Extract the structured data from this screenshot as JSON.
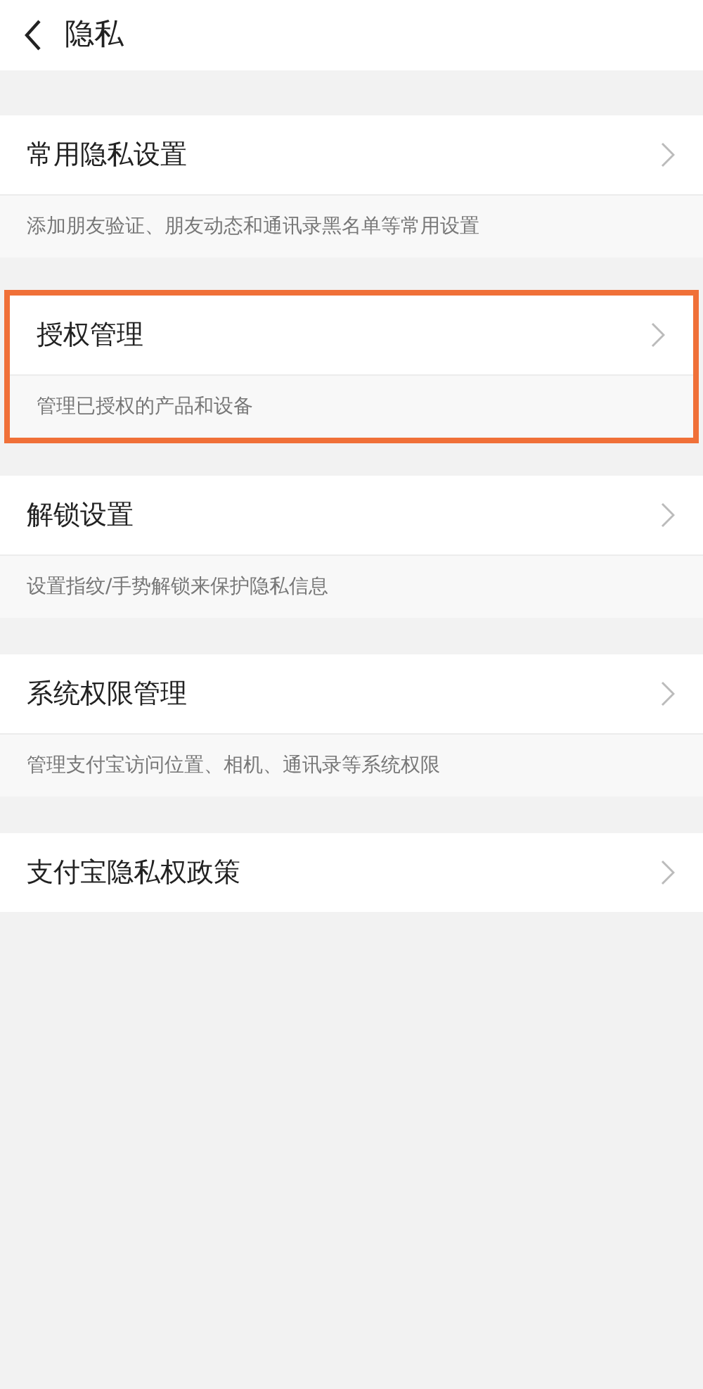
{
  "header": {
    "title": "隐私"
  },
  "items": [
    {
      "title": "常用隐私设置",
      "description": "添加朋友验证、朋友动态和通讯录黑名单等常用设置",
      "highlighted": false
    },
    {
      "title": "授权管理",
      "description": "管理已授权的产品和设备",
      "highlighted": true
    },
    {
      "title": "解锁设置",
      "description": "设置指纹/手势解锁来保护隐私信息",
      "highlighted": false
    },
    {
      "title": "系统权限管理",
      "description": "管理支付宝访问位置、相机、通讯录等系统权限",
      "highlighted": false
    },
    {
      "title": "支付宝隐私权政策",
      "highlighted": false
    }
  ]
}
